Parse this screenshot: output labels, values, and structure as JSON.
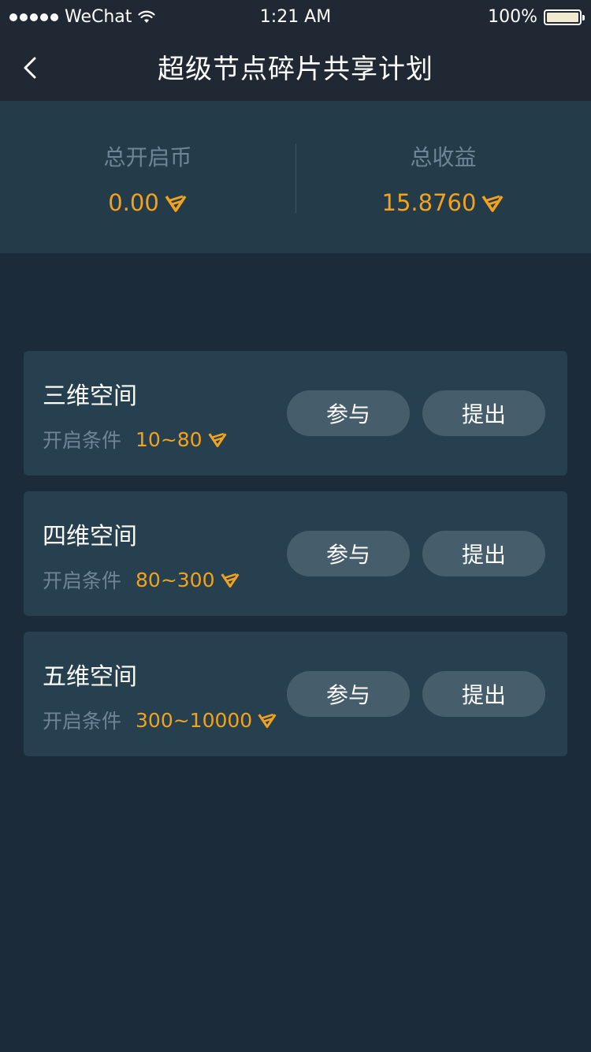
{
  "status_bar": {
    "carrier": "WeChat",
    "time": "1:21 AM",
    "battery": "100%"
  },
  "nav": {
    "title": "超级节点碎片共享计划",
    "back_icon": "chevron-left-icon"
  },
  "summary": {
    "total_open_label": "总开启币",
    "total_open_value": "0.00",
    "total_income_label": "总收益",
    "total_income_value": "15.8760",
    "currency_icon": "v-currency-icon"
  },
  "plans": [
    {
      "title": "三维空间",
      "cond_label": "开启条件",
      "range": "10~80",
      "join_label": "参与",
      "withdraw_label": "提出"
    },
    {
      "title": "四维空间",
      "cond_label": "开启条件",
      "range": "80~300",
      "join_label": "参与",
      "withdraw_label": "提出"
    },
    {
      "title": "五维空间",
      "cond_label": "开启条件",
      "range": "300~10000",
      "join_label": "参与",
      "withdraw_label": "提出"
    }
  ],
  "colors": {
    "background": "#1b2b39",
    "header": "#1f2833",
    "summary_bg": "#243b4a",
    "card_bg": "#26404f",
    "button_bg": "#465d6c",
    "accent": "#f2a21b",
    "muted": "#6f8597"
  }
}
